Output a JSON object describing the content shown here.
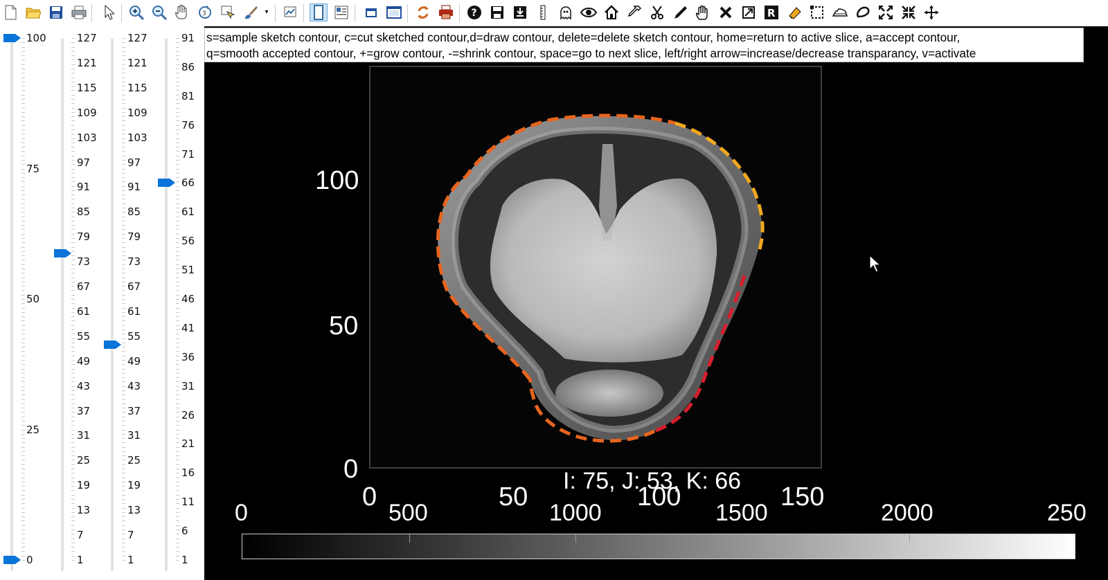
{
  "toolbar": {
    "icons": [
      "new-file-icon",
      "open-folder-icon",
      "save-icon",
      "print-icon",
      "pointer-icon",
      "zoom-in-icon",
      "zoom-out-icon",
      "pan-hand-icon",
      "rotate-3d-icon",
      "data-cursor-icon",
      "brush-icon",
      "link-plot-icon",
      "layout-icon",
      "panel-icon",
      "window-icon",
      "maximize-window-icon",
      "refresh-icon",
      "printer-red-icon",
      "help-icon",
      "save-disk-icon",
      "download-icon",
      "ruler-icon",
      "ghost-icon",
      "eye-icon",
      "home-icon",
      "eyedropper-icon",
      "scissors-icon",
      "pen-icon",
      "hand-icon",
      "close-x-icon",
      "crop-icon",
      "r-icon",
      "eraser-icon",
      "select-rect-icon",
      "iron-icon",
      "lasso-icon",
      "expand-icon",
      "shrink-icon",
      "move-icon"
    ]
  },
  "hint": {
    "line1": "s=sample sketch contour, c=cut sketched contour,d=draw contour, delete=delete sketch contour, home=return to active slice, a=accept contour,",
    "line2": "q=smooth accepted contour, +=grow contour, -=shrink contour, space=go to next slice, left/right arrow=increase/decrease transparancy, v=activate"
  },
  "sliders": {
    "opacity": {
      "labels": [
        "100",
        "75",
        "50",
        "25",
        "0"
      ],
      "value": 100,
      "low_value": 0
    },
    "slice_i": {
      "labels": [
        "127",
        "121",
        "115",
        "109",
        "103",
        "97",
        "91",
        "85",
        "79",
        "73",
        "67",
        "61",
        "55",
        "49",
        "43",
        "37",
        "31",
        "25",
        "19",
        "13",
        "7",
        "1"
      ],
      "value": 75
    },
    "slice_j": {
      "labels": [
        "127",
        "121",
        "115",
        "109",
        "103",
        "97",
        "91",
        "85",
        "79",
        "73",
        "67",
        "61",
        "55",
        "49",
        "43",
        "37",
        "31",
        "25",
        "19",
        "13",
        "7",
        "1"
      ],
      "value": 53
    },
    "slice_k": {
      "labels": [
        "91",
        "86",
        "81",
        "76",
        "71",
        "66",
        "61",
        "56",
        "51",
        "46",
        "41",
        "36",
        "31",
        "26",
        "21",
        "16",
        "11",
        "6",
        "1"
      ],
      "value": 66
    }
  },
  "image_axes": {
    "x_ticks": [
      "0",
      "50",
      "100",
      "150"
    ],
    "y_ticks": [
      "100",
      "50",
      "0"
    ]
  },
  "coordinates": "I: 75, J: 53, K: 66",
  "colorbar": {
    "ticks": [
      "0",
      "500",
      "1000",
      "1500",
      "2000",
      "250"
    ]
  },
  "colors": {
    "contour_orange": "#e8641e",
    "contour_yellow": "#f0a81e",
    "contour_red": "#d81e2c",
    "slider_thumb": "#0a74d8"
  }
}
